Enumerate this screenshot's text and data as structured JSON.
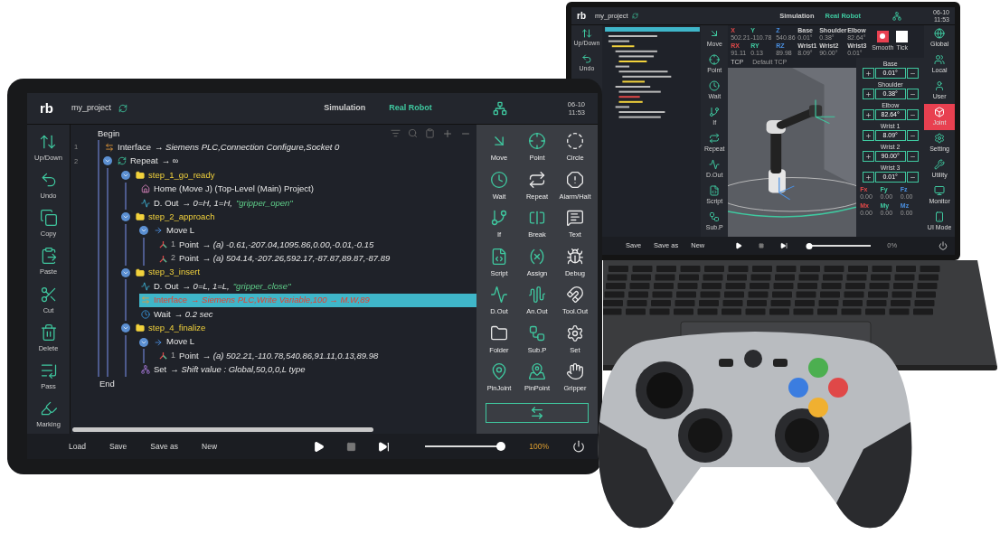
{
  "tablet": {
    "header": {
      "logo": "rb",
      "project": "my_project",
      "tabs": [
        {
          "label": "Simulation",
          "selected": false
        },
        {
          "label": "Real Robot",
          "selected": true
        }
      ],
      "date": "06-10",
      "time": "11:53"
    },
    "toolbar": [
      "Up/Down",
      "Undo",
      "Copy",
      "Paste",
      "Cut",
      "Delete",
      "Pass",
      "Marking"
    ],
    "program": {
      "begin": "Begin",
      "end": "End",
      "lines": [
        {
          "number": "1",
          "kind": "interface",
          "label": "Interface",
          "detail": "→ Siemens PLC,Connection Configure,Socket 0",
          "selected": false
        },
        {
          "number": "2",
          "kind": "repeat",
          "label": "Repeat",
          "detail": "→ ∞",
          "expanded": true,
          "selected": false,
          "children": [
            {
              "kind": "folder",
              "label": "step_1_go_ready",
              "expanded": true,
              "selected": false,
              "children": [
                {
                  "kind": "home",
                  "label": "Home (Move J) (Top-Level (Main) Project)",
                  "selected": false
                },
                {
                  "kind": "dout",
                  "label": "D. Out",
                  "detail": "→ 0=H, 1=H,",
                  "quote": "\"gripper_open\"",
                  "selected": false
                }
              ]
            },
            {
              "kind": "folder",
              "label": "step_2_approach",
              "expanded": true,
              "selected": false,
              "children": [
                {
                  "kind": "move",
                  "label": "Move L",
                  "expanded": true,
                  "selected": false,
                  "children": [
                    {
                      "kind": "point",
                      "index": "1",
                      "label": "Point",
                      "detail": "→ (a) -0.61,-207.04,1095.86,0.00,-0.01,-0.15",
                      "selected": false
                    },
                    {
                      "kind": "point",
                      "index": "2",
                      "label": "Point",
                      "detail": "→ (a) 504.14,-207.26,592.17,-87.87,89.87,-87.89",
                      "selected": false
                    }
                  ]
                }
              ]
            },
            {
              "kind": "folder",
              "label": "step_3_insert",
              "expanded": true,
              "selected": false,
              "children": [
                {
                  "kind": "dout",
                  "label": "D. Out",
                  "detail": "→ 0=L, 1=L,",
                  "quote": "\"gripper_close\"",
                  "selected": false
                },
                {
                  "kind": "interface",
                  "label": "Interface",
                  "detail": "→ Siemens PLC,Write Variable,100 → M.W,89",
                  "selected": true
                },
                {
                  "kind": "wait",
                  "label": "Wait",
                  "detail": "→ 0.2 sec",
                  "selected": false
                }
              ]
            },
            {
              "kind": "folder",
              "label": "step_4_finalize",
              "expanded": true,
              "selected": false,
              "children": [
                {
                  "kind": "move",
                  "label": "Move L",
                  "expanded": true,
                  "selected": false,
                  "children": [
                    {
                      "kind": "point",
                      "index": "1",
                      "label": "Point",
                      "detail": "→ (a) 502.21,-110.78,540.86,91.11,0.13,89.98",
                      "selected": false
                    }
                  ]
                },
                {
                  "kind": "set",
                  "label": "Set",
                  "detail": "→ Shift value : Global,50,0,0,L type",
                  "selected": false
                }
              ]
            }
          ]
        }
      ]
    },
    "palette": [
      "Move",
      "Point",
      "Circle",
      "Wait",
      "Repeat",
      "Alarm/Halt",
      "If",
      "Break",
      "Text",
      "Script",
      "Assign",
      "Debug",
      "D.Out",
      "An.Out",
      "Tool.Out",
      "Folder",
      "Sub.P",
      "Set",
      "PinJoint",
      "PinPoint",
      "Gripper"
    ],
    "bottom": {
      "buttons": [
        "Load",
        "Save",
        "Save as",
        "New"
      ],
      "speed": {
        "level": 1.0,
        "reading": "100%"
      }
    }
  },
  "laptop": {
    "header": {
      "logo": "rb",
      "project": "my_project",
      "tabs": [
        {
          "label": "Simulation",
          "selected": false
        },
        {
          "label": "Real Robot",
          "selected": true
        }
      ],
      "date": "06-10",
      "time": "11:53"
    },
    "toolbar": [
      "Up/Down",
      "Undo"
    ],
    "commands": [
      "Move",
      "Point",
      "Wait",
      "If",
      "Repeat",
      "D.Out",
      "Script",
      "Sub.P"
    ],
    "pose": [
      {
        "label": "X",
        "value": "502.21"
      },
      {
        "label": "Y",
        "value": "-110.78"
      },
      {
        "label": "Z",
        "value": "540.86"
      },
      {
        "label": "Base",
        "value": "0.01°"
      },
      {
        "label": "Shoulder",
        "value": "0.38°"
      },
      {
        "label": "Elbow",
        "value": "82.64°"
      },
      {
        "label": "RX",
        "value": "91.11"
      },
      {
        "label": "RY",
        "value": "0.13"
      },
      {
        "label": "RZ",
        "value": "89.98"
      },
      {
        "label": "Wrist1",
        "value": "8.09°"
      },
      {
        "label": "Wrist2",
        "value": "90.00°"
      },
      {
        "label": "Wrist3",
        "value": "0.01°"
      }
    ],
    "modes": [
      "Smooth",
      "Tick"
    ],
    "tcp": {
      "label": "TCP",
      "value": "Default TCP"
    },
    "joints": [
      {
        "name": "Base",
        "value": "0.01°"
      },
      {
        "name": "Shoulder",
        "value": "0.38°"
      },
      {
        "name": "Elbow",
        "value": "82.64°"
      },
      {
        "name": "Wrist 1",
        "value": "8.09°"
      },
      {
        "name": "Wrist 2",
        "value": "90.00°"
      },
      {
        "name": "Wrist 3",
        "value": "0.01°"
      }
    ],
    "forces": [
      {
        "label": "Fx",
        "value": "0.00"
      },
      {
        "label": "Fy",
        "value": "0.00"
      },
      {
        "label": "Fz",
        "value": "0.00"
      },
      {
        "label": "Mx",
        "value": "0.00"
      },
      {
        "label": "My",
        "value": "0.00"
      },
      {
        "label": "Mz",
        "value": "0.00"
      }
    ],
    "frames": [
      {
        "label": "Global",
        "selected": false
      },
      {
        "label": "Local",
        "selected": false
      },
      {
        "label": "User",
        "selected": false
      },
      {
        "label": "Joint",
        "selected": true
      },
      {
        "label": "Setting",
        "selected": false
      },
      {
        "label": "Utility",
        "selected": false
      },
      {
        "label": "Monitor",
        "selected": false
      },
      {
        "label": "UI Mode",
        "selected": false
      }
    ],
    "bottom": {
      "buttons": [
        "Save",
        "Save as",
        "New"
      ],
      "speed": {
        "level": 0.0,
        "reading": "0%"
      }
    }
  }
}
